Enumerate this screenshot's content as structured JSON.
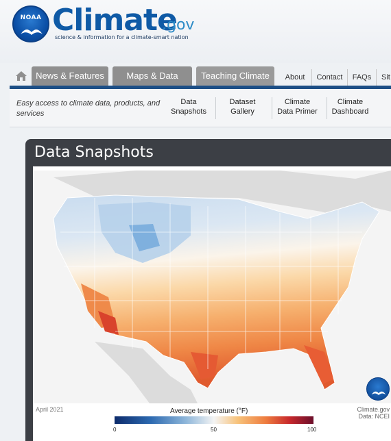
{
  "header": {
    "noaa_label": "NOAA",
    "brand_name": "Climate",
    "brand_tld": ".gov",
    "tagline": "science & information for a climate-smart nation"
  },
  "nav": {
    "tabs": [
      {
        "label": "News & Features"
      },
      {
        "label": "Maps & Data"
      },
      {
        "label": "Teaching Climate"
      }
    ],
    "utility": [
      {
        "label": "About"
      },
      {
        "label": "Contact"
      },
      {
        "label": "FAQs"
      },
      {
        "label": "Sit"
      }
    ]
  },
  "subnav": {
    "tagline": "Easy access to climate data, products, and services",
    "links": [
      {
        "line1": "Data",
        "line2": "Snapshots"
      },
      {
        "line1": "Dataset",
        "line2": "Gallery"
      },
      {
        "line1": "Climate",
        "line2": "Data Primer"
      },
      {
        "line1": "Climate",
        "line2": "Dashboard"
      }
    ]
  },
  "panel": {
    "title": "Data Snapshots",
    "date": "April 2021",
    "credit_line1": "Climate.gov",
    "credit_line2": "Data: NCEI"
  },
  "legend": {
    "title": "Average temperature (°F)",
    "ticks": [
      "0",
      "50",
      "100"
    ]
  },
  "colors": {
    "brand_blue": "#0f5aa6",
    "nav_gray": "#8f8f8f",
    "nav_rule": "#1d4f86",
    "panel_bg": "#3c3f45"
  }
}
